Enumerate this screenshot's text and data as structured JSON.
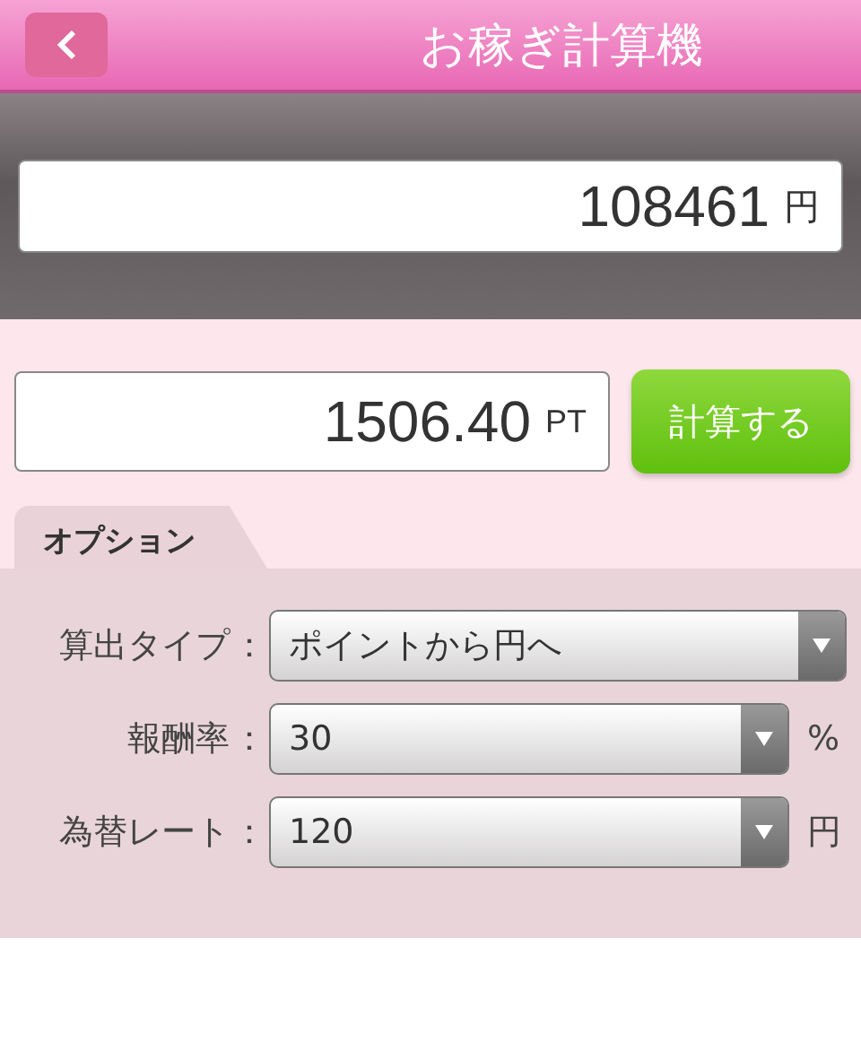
{
  "header": {
    "title": "お稼ぎ計算機"
  },
  "yen_field": {
    "value": "108461",
    "unit": "円"
  },
  "point_field": {
    "value": "1506.40",
    "unit": "PT"
  },
  "calculate_button": {
    "label": "計算する"
  },
  "options": {
    "tab": "オプション",
    "rows": [
      {
        "label": "算出タイプ",
        "colon": "：",
        "value": "ポイントから円へ"
      },
      {
        "label": "報酬率",
        "colon": "：",
        "value": "30",
        "unit": "%"
      },
      {
        "label": "為替レート",
        "colon": "：",
        "value": "120",
        "unit": "円"
      }
    ]
  }
}
